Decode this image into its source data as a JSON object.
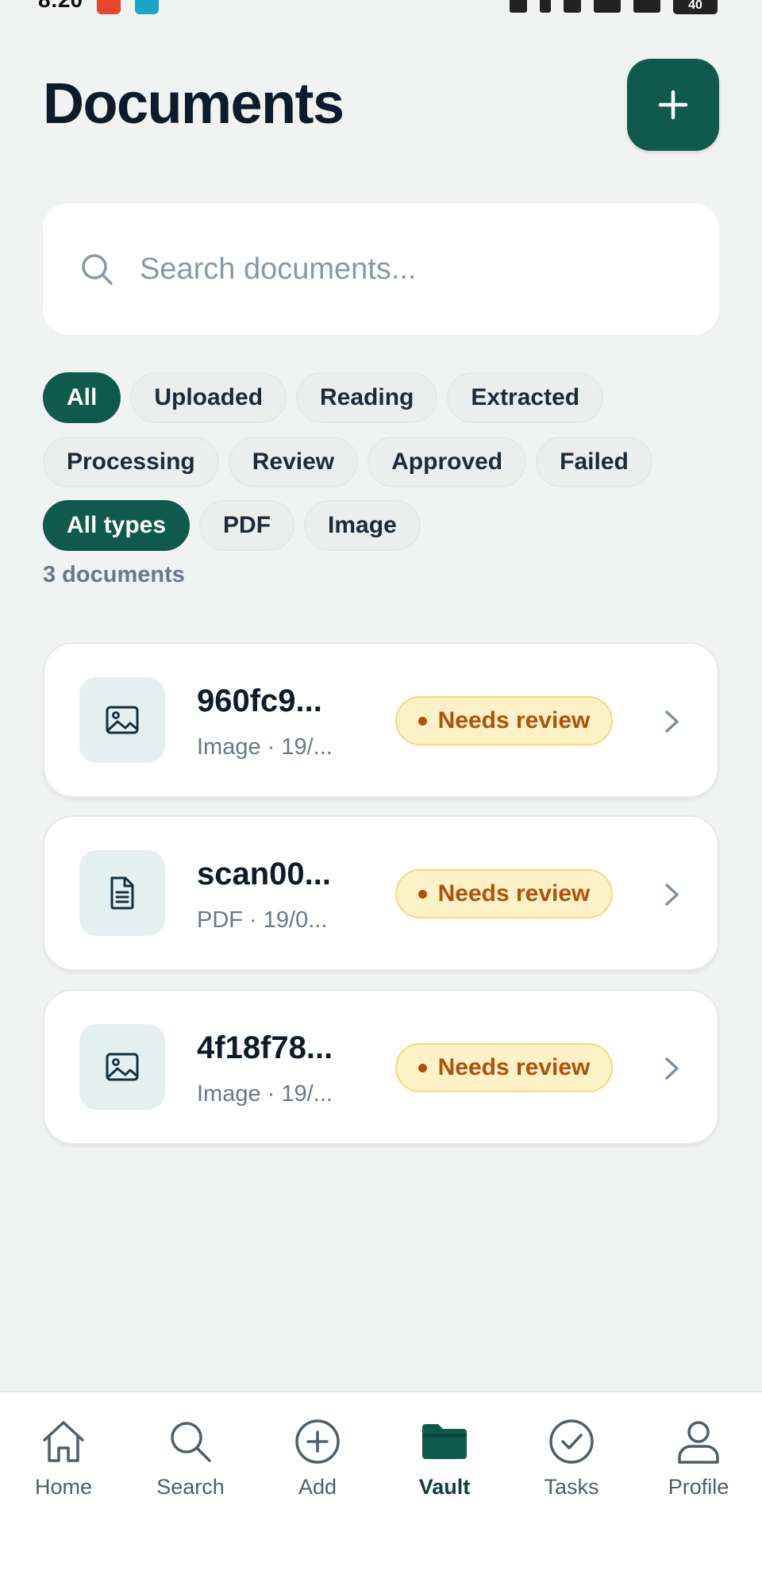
{
  "status_bar": {
    "time": "8:20",
    "battery": "40",
    "app_icon_colors": [
      "#e8452c",
      "#17a6c4"
    ]
  },
  "header": {
    "title": "Documents",
    "add_icon": "plus-icon"
  },
  "search": {
    "placeholder": "Search documents...",
    "value": "",
    "icon": "search-icon"
  },
  "status_filters": {
    "chips": [
      "All",
      "Uploaded",
      "Reading",
      "Extracted",
      "Processing",
      "Review",
      "Approved",
      "Failed"
    ],
    "selected": "All"
  },
  "type_filters": {
    "chips": [
      "All types",
      "PDF",
      "Image"
    ],
    "selected": "All types"
  },
  "document_count": "3 documents",
  "documents": [
    {
      "icon": "image-icon",
      "name": "960fc9...",
      "meta": "Image · 19/...",
      "status": "Needs review"
    },
    {
      "icon": "file-text-icon",
      "name": "scan00...",
      "meta": "PDF · 19/0...",
      "status": "Needs review"
    },
    {
      "icon": "image-icon",
      "name": "4f18f78...",
      "meta": "Image · 19/...",
      "status": "Needs review"
    }
  ],
  "bottom_nav": {
    "items": [
      {
        "label": "Home",
        "icon": "home-icon"
      },
      {
        "label": "Search",
        "icon": "search-icon"
      },
      {
        "label": "Add",
        "icon": "plus-circle-icon"
      },
      {
        "label": "Vault",
        "icon": "folder-icon"
      },
      {
        "label": "Tasks",
        "icon": "check-circle-icon"
      },
      {
        "label": "Profile",
        "icon": "user-icon"
      }
    ],
    "active": "Vault"
  },
  "colors": {
    "brand": "#0f5a4c",
    "background": "#f1f3f2",
    "badge_bg": "#fdf1c6",
    "badge_text": "#b0510d",
    "muted_text": "#6a7888"
  }
}
